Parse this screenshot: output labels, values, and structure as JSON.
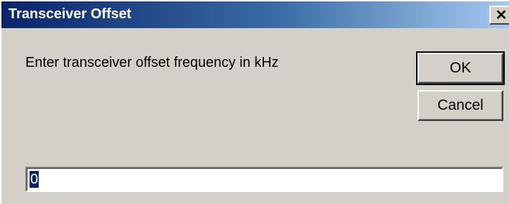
{
  "window": {
    "title": "Transceiver Offset",
    "close_glyph": "✕"
  },
  "dialog": {
    "prompt": "Enter transceiver offset frequency in kHz",
    "ok_label": "OK",
    "cancel_label": "Cancel",
    "input_value": "0"
  },
  "colors": {
    "title_gradient_start": "#0a246a",
    "title_gradient_end": "#a6caf0",
    "dialog_bg": "#d4d0c8",
    "selection": "#0a246a"
  },
  "icons": {
    "close": "close-icon"
  }
}
